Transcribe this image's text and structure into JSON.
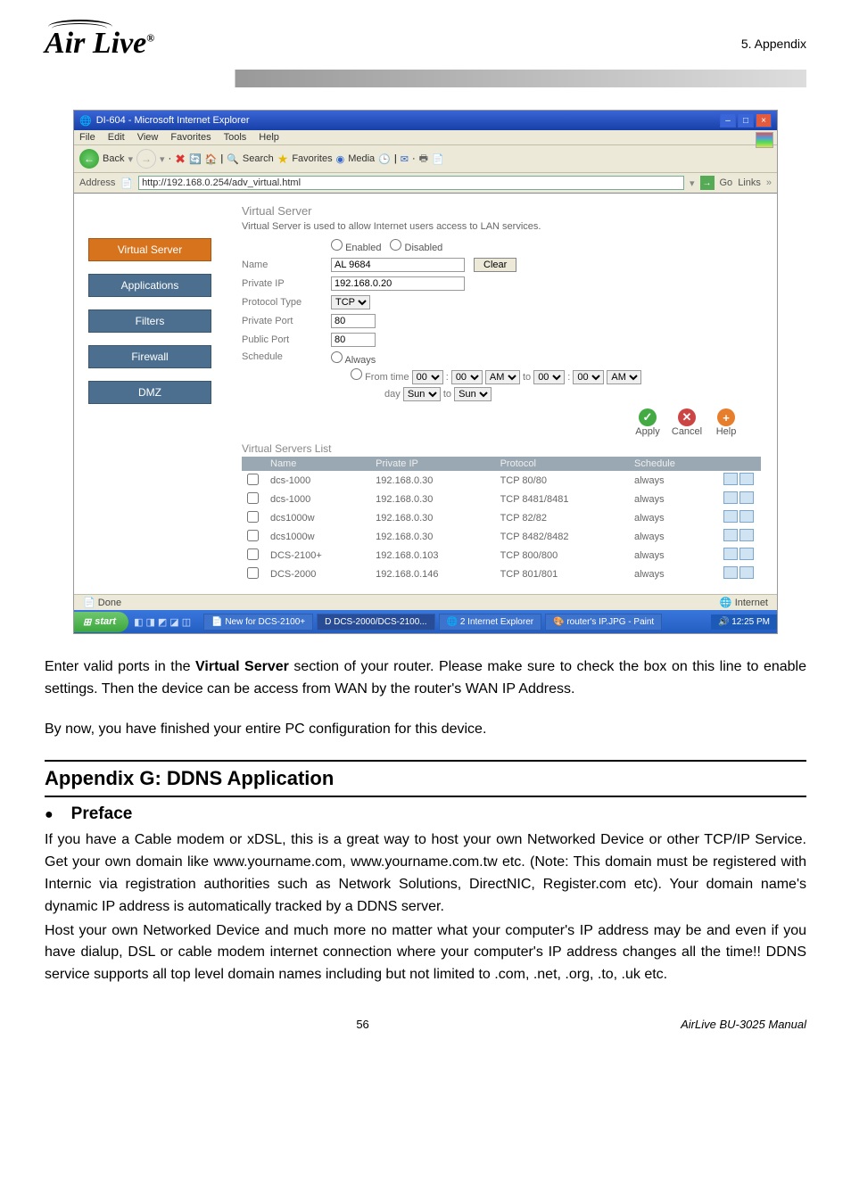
{
  "header": {
    "appendix_label": "5. Appendix",
    "logo_text": "Air Live",
    "logo_reg": "®"
  },
  "ie": {
    "title": "DI-604 - Microsoft Internet Explorer",
    "menus": [
      "File",
      "Edit",
      "View",
      "Favorites",
      "Tools",
      "Help"
    ],
    "toolbar": {
      "back": "Back",
      "search": "Search",
      "favorites": "Favorites",
      "media": "Media"
    },
    "address_label": "Address",
    "address_value": "http://192.168.0.254/adv_virtual.html",
    "go": "Go",
    "links": "Links",
    "status_done": "Done",
    "status_zone": "Internet"
  },
  "sidenav": {
    "items": [
      "Virtual Server",
      "Applications",
      "Filters",
      "Firewall",
      "DMZ"
    ],
    "active_index": 0
  },
  "panel": {
    "title": "Virtual Server",
    "desc": "Virtual Server is used to allow Internet users access to LAN services.",
    "enabled": "Enabled",
    "disabled": "Disabled",
    "labels": {
      "name": "Name",
      "private_ip": "Private IP",
      "protocol_type": "Protocol Type",
      "private_port": "Private Port",
      "public_port": "Public Port",
      "schedule": "Schedule"
    },
    "values": {
      "name": "AL 9684",
      "private_ip": "192.168.0.20",
      "protocol_type": "TCP",
      "private_port": "80",
      "public_port": "80"
    },
    "clear": "Clear",
    "sched_always": "Always",
    "sched_from": "From",
    "sched_time": "time",
    "sched_to": "to",
    "sched_day": "day",
    "sel_hour": "00",
    "sel_min": "00",
    "sel_ampm": "AM",
    "sel_day": "Sun",
    "actions": {
      "apply": "Apply",
      "cancel": "Cancel",
      "help": "Help"
    },
    "list_title": "Virtual Servers List",
    "columns": [
      "Name",
      "Private IP",
      "Protocol",
      "Schedule"
    ],
    "rows": [
      {
        "name": "dcs-1000",
        "ip": "192.168.0.30",
        "proto": "TCP 80/80",
        "sched": "always"
      },
      {
        "name": "dcs-1000",
        "ip": "192.168.0.30",
        "proto": "TCP 8481/8481",
        "sched": "always"
      },
      {
        "name": "dcs1000w",
        "ip": "192.168.0.30",
        "proto": "TCP 82/82",
        "sched": "always"
      },
      {
        "name": "dcs1000w",
        "ip": "192.168.0.30",
        "proto": "TCP 8482/8482",
        "sched": "always"
      },
      {
        "name": "DCS-2100+",
        "ip": "192.168.0.103",
        "proto": "TCP 800/800",
        "sched": "always"
      },
      {
        "name": "DCS-2000",
        "ip": "192.168.0.146",
        "proto": "TCP 801/801",
        "sched": "always"
      }
    ]
  },
  "taskbar": {
    "start": "start",
    "items": [
      "New for DCS-2100+",
      "DCS-2000/DCS-2100...",
      "2 Internet Explorer",
      "router's IP.JPG - Paint"
    ],
    "time": "12:25 PM"
  },
  "body": {
    "p1_pre": "Enter valid ports in the ",
    "p1_bold": "Virtual Server",
    "p1_post": " section of your router.    Please make sure to check the box on this line to enable settings.    Then the device can be access from WAN by the router's WAN IP Address.",
    "p2": "By now, you have finished your entire PC configuration for this device.",
    "section": "Appendix G: DDNS Application",
    "preface": "Preface",
    "p3": "If you have a Cable modem or xDSL, this is a great way to host your own Networked Device or other TCP/IP Service.    Get your own domain like www.yourname.com, www.yourname.com.tw etc.    (Note: This domain must be registered with Internic via registration authorities such as Network Solutions, DirectNIC, Register.com etc).    Your domain name's dynamic IP address is automatically tracked by a DDNS server.",
    "p4": "Host your own Networked Device and much more no matter what your computer's IP address may be and even if you have dialup, DSL or cable modem internet connection where your computer's IP address changes all the time!!    DDNS service supports all top level domain names including but not limited to .com, .net, .org, .to, .uk etc."
  },
  "footer": {
    "page": "56",
    "manual": "AirLive BU-3025 Manual"
  }
}
